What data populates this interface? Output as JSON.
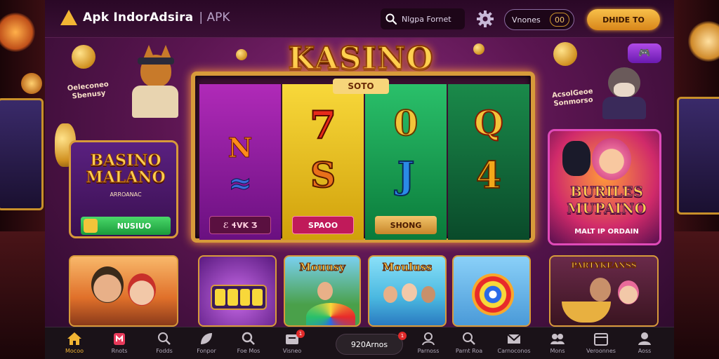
{
  "colors": {
    "accent": "#f2b534",
    "cta_bg": "#e8a02a",
    "nav_active": "#f2b534",
    "badge": "#e02a2a"
  },
  "header": {
    "app_title": "Apk IndorAdsira",
    "app_suffix": "| APK",
    "search_label": "Nlgpa Fornet",
    "toggle_label": "Vnones",
    "toggle_value": "00",
    "cta_label": "DHIDE TO"
  },
  "hero": {
    "title": "KASINO",
    "subtitle": "SOTO",
    "reels": [
      {
        "symbols": [
          "N",
          "≈"
        ],
        "button": "ℰ ɬVK Ʒ"
      },
      {
        "symbols": [
          "7",
          "S"
        ],
        "button": "SPAOO"
      },
      {
        "symbols": [
          "0",
          "J"
        ],
        "button": "SHONG"
      },
      {
        "symbols": [
          "Q",
          "4"
        ],
        "button": ""
      }
    ]
  },
  "left_promo": {
    "text": "Oeleconeo Sbenusy"
  },
  "left_banner": {
    "title": "BASINO MALANO",
    "subtitle": "ARROANAC",
    "button": "NUSIUO"
  },
  "right_promo": {
    "text": "AcsolGeoe Sonmorso"
  },
  "right_banner": {
    "title": "BURILES MUPAINO",
    "subtitle": "MALT IP ORDAIN"
  },
  "top_right_badge": {
    "icon": "gamepad-icon"
  },
  "tiles": [
    {
      "label": ""
    },
    {
      "label": ""
    },
    {
      "label": "Mouusy"
    },
    {
      "label": "Mouluss"
    },
    {
      "label": ""
    },
    {
      "label": "PARTYKEANSS"
    }
  ],
  "bottom_nav": {
    "items": [
      {
        "label": "Mocoo",
        "icon": "home-icon",
        "badge": ""
      },
      {
        "label": "Rnots",
        "icon": "card-icon",
        "badge": ""
      },
      {
        "label": "Fodds",
        "icon": "search-icon",
        "badge": ""
      },
      {
        "label": "Fonpor",
        "icon": "leaf-icon",
        "badge": ""
      },
      {
        "label": "Foe Mos",
        "icon": "search-icon",
        "badge": ""
      },
      {
        "label": "Visneo",
        "icon": "wallet-icon",
        "badge": "1"
      },
      {
        "label": "Parnoss",
        "icon": "user-icon",
        "badge": ""
      },
      {
        "label": "Parnt Roa",
        "icon": "search-icon",
        "badge": ""
      },
      {
        "label": "Carnoconos",
        "icon": "mail-icon",
        "badge": ""
      },
      {
        "label": "Mons",
        "icon": "group-icon",
        "badge": ""
      },
      {
        "label": "Veroonnes",
        "icon": "calendar-icon",
        "badge": ""
      },
      {
        "label": "Aoss",
        "icon": "profile-icon",
        "badge": ""
      }
    ],
    "center_pill": {
      "label": "920Arnos",
      "badge": "1"
    }
  }
}
